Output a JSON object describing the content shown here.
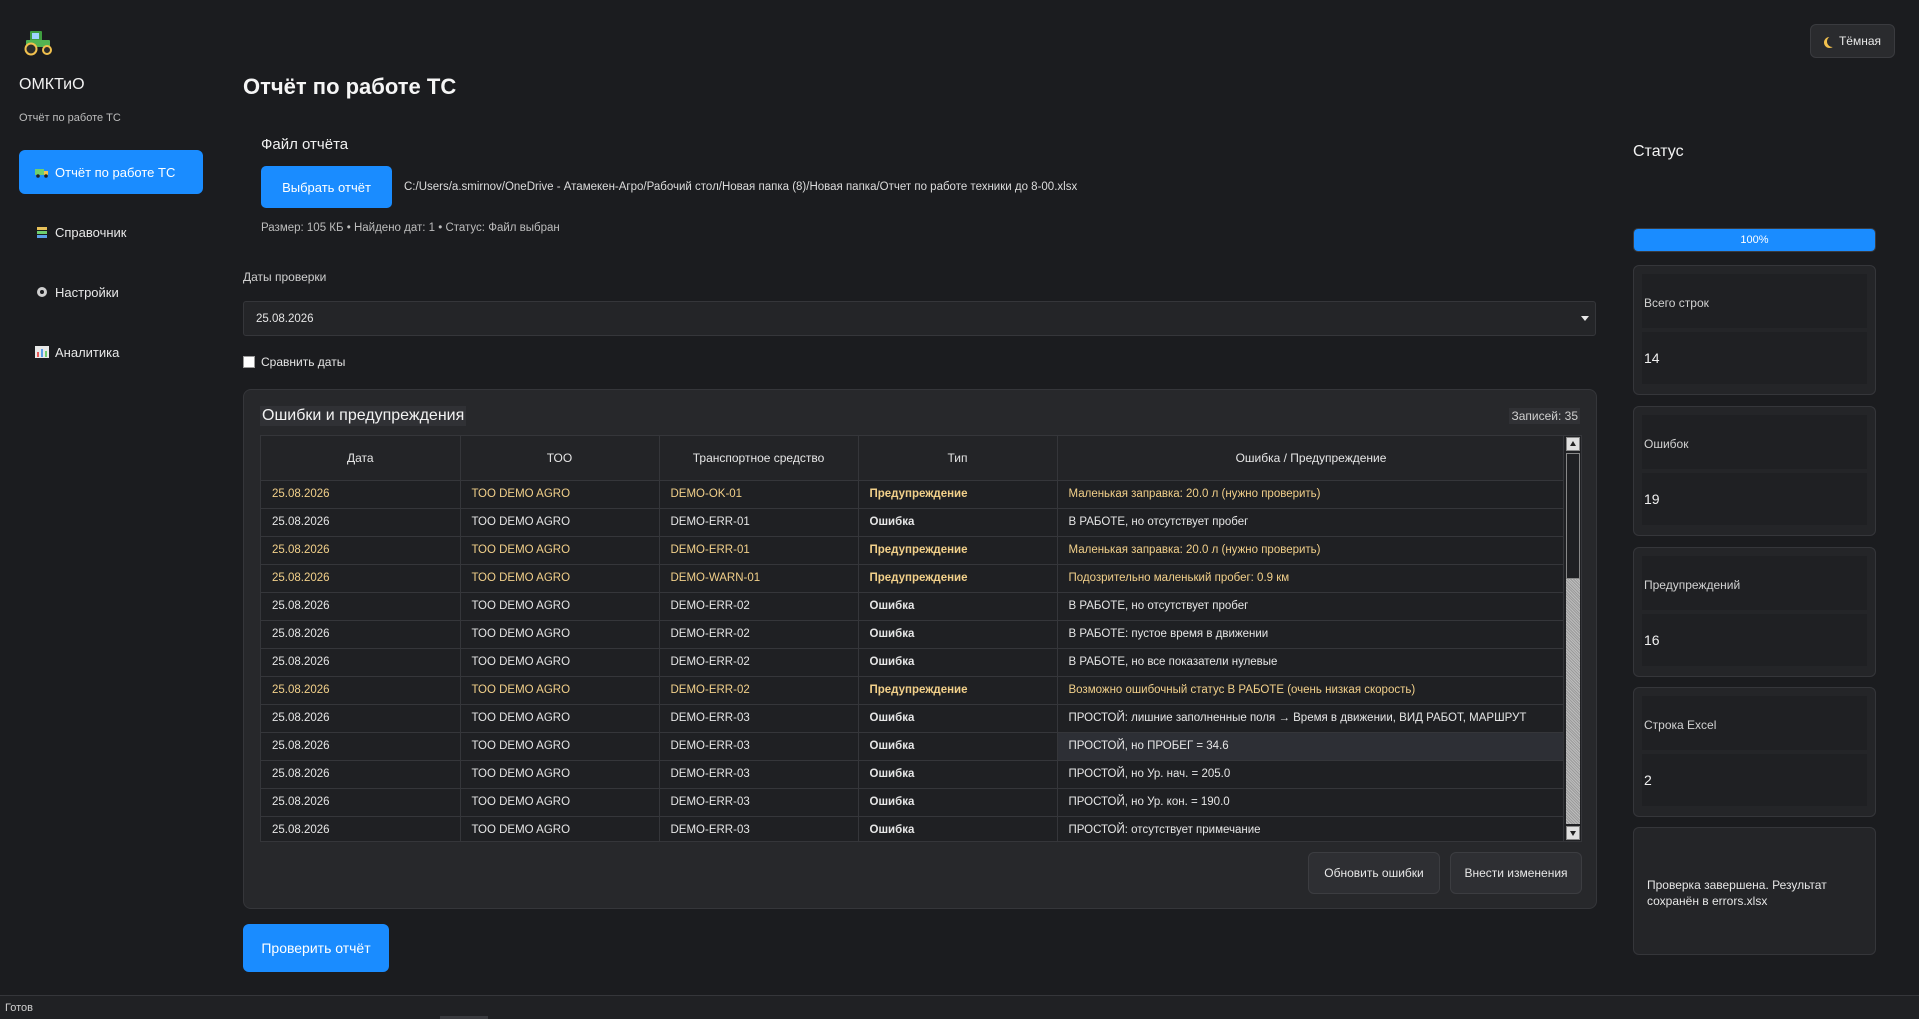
{
  "sidebar": {
    "logo_icon": "tractor-icon",
    "app_title": "ОМКТиО",
    "app_subtitle": "Отчёт по работе ТС",
    "items": [
      {
        "label": "Отчёт по работе ТС",
        "icon": "truck-icon",
        "active": true
      },
      {
        "label": "Справочник",
        "icon": "books-icon",
        "active": false
      },
      {
        "label": "Настройки",
        "icon": "gear-icon",
        "active": false
      },
      {
        "label": "Аналитика",
        "icon": "bar-chart-icon",
        "active": false
      }
    ]
  },
  "theme": {
    "label": "Тёмная",
    "icon": "moon-icon"
  },
  "main": {
    "title": "Отчёт по работе ТС",
    "file_section_title": "Файл отчёта",
    "choose_button": "Выбрать отчёт",
    "file_path": "C:/Users/a.smirnov/OneDrive - Атамекен-Агро/Рабочий стол/Новая папка (8)/Новая папка/Отчет по работе техники до 8-00.xlsx",
    "file_info": "Размер: 105 КБ • Найдено дат: 1 • Статус: Файл выбран",
    "dates_label": "Даты проверки",
    "selected_date": "25.08.2026",
    "compare_label": "Сравнить даты",
    "check_button": "Проверить отчёт"
  },
  "errors": {
    "title": "Ошибки и предупреждения",
    "records": "Записей: 35",
    "columns": [
      "Дата",
      "ТОО",
      "Транспортное средство",
      "Тип",
      "Ошибка / Предупреждение"
    ],
    "rows": [
      {
        "date": "25.08.2026",
        "too": "ТОО DEMO AGRO",
        "vehicle": "DEMO-OK-01",
        "type": "Предупреждение",
        "message": "Маленькая заправка: 20.0 л (нужно проверить)",
        "kind": "warn"
      },
      {
        "date": "25.08.2026",
        "too": "ТОО DEMO AGRO",
        "vehicle": "DEMO-ERR-01",
        "type": "Ошибка",
        "message": "В РАБОТЕ, но отсутствует пробег",
        "kind": "error"
      },
      {
        "date": "25.08.2026",
        "too": "ТОО DEMO AGRO",
        "vehicle": "DEMO-ERR-01",
        "type": "Предупреждение",
        "message": "Маленькая заправка: 20.0 л (нужно проверить)",
        "kind": "warn"
      },
      {
        "date": "25.08.2026",
        "too": "ТОО DEMO AGRO",
        "vehicle": "DEMO-WARN-01",
        "type": "Предупреждение",
        "message": "Подозрительно маленький пробег: 0.9 км",
        "kind": "warn"
      },
      {
        "date": "25.08.2026",
        "too": "ТОО DEMO AGRO",
        "vehicle": "DEMO-ERR-02",
        "type": "Ошибка",
        "message": "В РАБОТЕ, но отсутствует пробег",
        "kind": "error"
      },
      {
        "date": "25.08.2026",
        "too": "ТОО DEMO AGRO",
        "vehicle": "DEMO-ERR-02",
        "type": "Ошибка",
        "message": "В РАБОТЕ: пустое время в движении",
        "kind": "error"
      },
      {
        "date": "25.08.2026",
        "too": "ТОО DEMO AGRO",
        "vehicle": "DEMO-ERR-02",
        "type": "Ошибка",
        "message": "В РАБОТЕ, но все показатели нулевые",
        "kind": "error"
      },
      {
        "date": "25.08.2026",
        "too": "ТОО DEMO AGRO",
        "vehicle": "DEMO-ERR-02",
        "type": "Предупреждение",
        "message": "Возможно ошибочный статус В РАБОТЕ (очень низкая скорость)",
        "kind": "warn"
      },
      {
        "date": "25.08.2026",
        "too": "ТОО DEMO AGRO",
        "vehicle": "DEMO-ERR-03",
        "type": "Ошибка",
        "message": "ПРОСТОЙ: лишние заполненные поля → Время в движении, ВИД РАБОТ, МАРШРУТ",
        "kind": "error"
      },
      {
        "date": "25.08.2026",
        "too": "ТОО DEMO AGRO",
        "vehicle": "DEMO-ERR-03",
        "type": "Ошибка",
        "message": "ПРОСТОЙ, но ПРОБЕГ = 34.6",
        "kind": "error",
        "selected": true
      },
      {
        "date": "25.08.2026",
        "too": "ТОО DEMO AGRO",
        "vehicle": "DEMO-ERR-03",
        "type": "Ошибка",
        "message": "ПРОСТОЙ, но Ур. нач. = 205.0",
        "kind": "error"
      },
      {
        "date": "25.08.2026",
        "too": "ТОО DEMO AGRO",
        "vehicle": "DEMO-ERR-03",
        "type": "Ошибка",
        "message": "ПРОСТОЙ, но Ур. кон. = 190.0",
        "kind": "error"
      },
      {
        "date": "25.08.2026",
        "too": "ТОО DEMO AGRO",
        "vehicle": "DEMO-ERR-03",
        "type": "Ошибка",
        "message": "ПРОСТОЙ: отсутствует примечание",
        "kind": "error"
      }
    ],
    "refresh_button": "Обновить ошибки",
    "apply_button": "Внести изменения"
  },
  "status": {
    "title": "Статус",
    "progress_percent": 100,
    "progress_text": "100%",
    "cards": [
      {
        "label": "Всего строк",
        "value": "14"
      },
      {
        "label": "Ошибок",
        "value": "19"
      },
      {
        "label": "Предупреждений",
        "value": "16"
      },
      {
        "label": "Строка Excel",
        "value": "2"
      }
    ],
    "message": "Проверка завершена. Результат сохранён в errors.xlsx"
  },
  "statusbar": {
    "text": "Готов"
  },
  "colors": {
    "accent": "#1a8cff",
    "warning_text": "#f2d08a",
    "background": "#1b1c1f"
  }
}
